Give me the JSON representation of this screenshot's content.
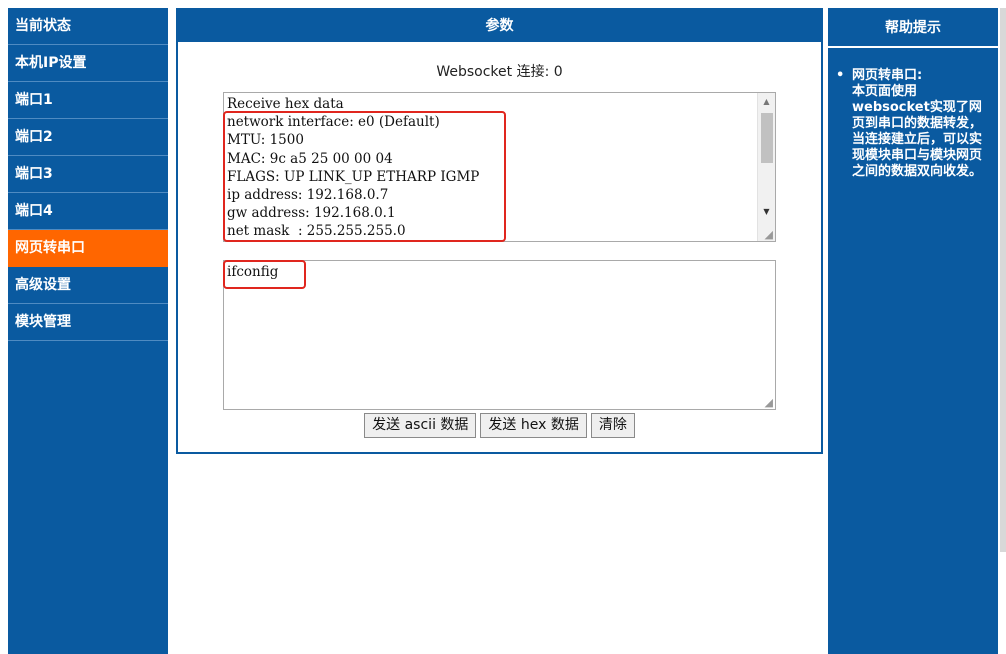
{
  "sidebar": {
    "items": [
      {
        "label": "当前状态",
        "active": false
      },
      {
        "label": "本机IP设置",
        "active": false
      },
      {
        "label": "端口1",
        "active": false
      },
      {
        "label": "端口2",
        "active": false
      },
      {
        "label": "端口3",
        "active": false
      },
      {
        "label": "端口4",
        "active": false
      },
      {
        "label": "网页转串口",
        "active": true
      },
      {
        "label": "高级设置",
        "active": false
      },
      {
        "label": "模块管理",
        "active": false
      }
    ]
  },
  "center": {
    "header": "参数",
    "ws_status": "Websocket 连接: 0",
    "receive_text": "Receive hex data\nnetwork interface: e0 (Default)\nMTU: 1500\nMAC: 9c a5 25 00 00 04\nFLAGS: UP LINK_UP ETHARP IGMP\nip address: 192.168.0.7\ngw address: 192.168.0.1\nnet mask  : 255.255.255.0",
    "send_text": "ifconfig",
    "buttons": {
      "send_ascii": "发送 ascii 数据",
      "send_hex": "发送 hex 数据",
      "clear": "清除"
    }
  },
  "help": {
    "header": "帮助提示",
    "title": "网页转串口:",
    "text": "本页面使用websocket实现了网页到串口的数据转发，当连接建立后，可以实现模块串口与模块网页之间的数据双向收发。"
  },
  "colors": {
    "panel_blue": "#0a5aa0",
    "active_orange": "#ff6600",
    "highlight_red": "#e0261e"
  }
}
